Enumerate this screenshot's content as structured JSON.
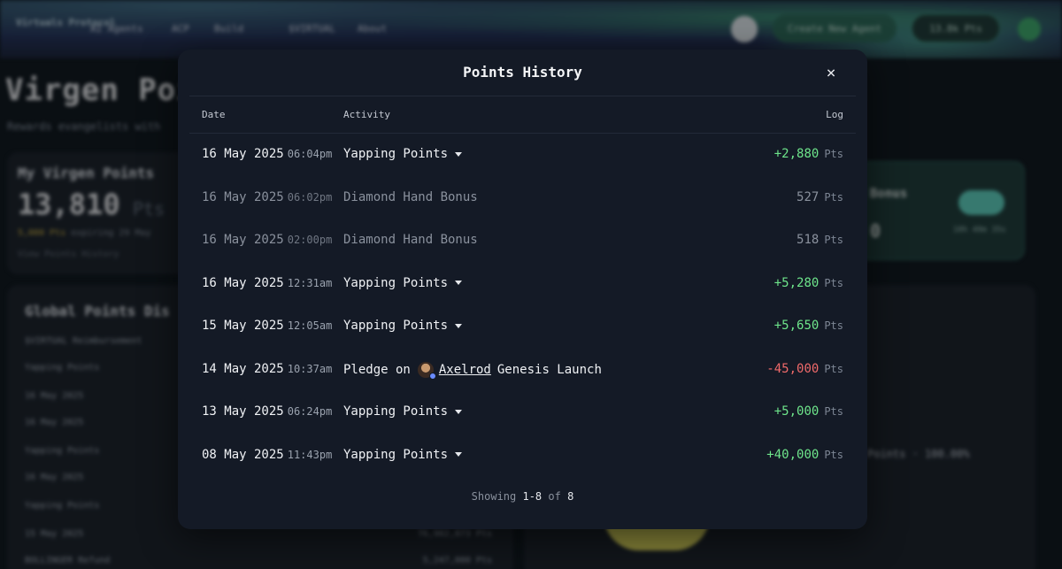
{
  "background": {
    "logo": "Virtuals Protocol",
    "nav": [
      "AI Agents",
      "ACP",
      "Build",
      "$VIRTUAL",
      "About"
    ],
    "create_agent": "Create New Agent",
    "top_points": "13.8k Pts",
    "page_title": "Virgen Poin",
    "page_subtitle": "Rewards evangelists with",
    "my_points": {
      "heading": "My Virgen Points",
      "value": "13,810",
      "unit": "Pts",
      "expiring_amount": "5,000 Pts",
      "expiring_text": "expiring 29 May",
      "claim_link": "View Points History"
    },
    "bonus": {
      "title": "Bonus",
      "value": "0",
      "sub": "10h 40m 35s"
    },
    "distribution": {
      "heading": "Global Points Dis",
      "rows": [
        "$VIRTUAL Reimbursement",
        "Yapping Points",
        "16 May 2025",
        "16 May 2025",
        "Yapping Points",
        "16 May 2025",
        "Yapping Points",
        "15 May 2025",
        "BOLLINGER Refund"
      ],
      "values": [
        "",
        "",
        "",
        "",
        "",
        "",
        "",
        "76,902,873 Pts",
        "5,247,000 Pts"
      ]
    },
    "legend": "Points · 100.00%"
  },
  "modal": {
    "title": "Points History",
    "close_label": "×",
    "columns": {
      "date": "Date",
      "activity": "Activity",
      "log": "Log"
    },
    "rows": [
      {
        "date": "16 May 2025",
        "time": "06:04pm",
        "activity": "Yapping Points",
        "expandable": true,
        "log": "+2,880",
        "unit": "Pts",
        "kind": "pos",
        "dim": false
      },
      {
        "date": "16 May 2025",
        "time": "06:02pm",
        "activity": "Diamond Hand Bonus",
        "expandable": false,
        "log": "527",
        "unit": "Pts",
        "kind": "neutral",
        "dim": true
      },
      {
        "date": "16 May 2025",
        "time": "02:00pm",
        "activity": "Diamond Hand Bonus",
        "expandable": false,
        "log": "518",
        "unit": "Pts",
        "kind": "neutral",
        "dim": true
      },
      {
        "date": "16 May 2025",
        "time": "12:31am",
        "activity": "Yapping Points",
        "expandable": true,
        "log": "+5,280",
        "unit": "Pts",
        "kind": "pos",
        "dim": false
      },
      {
        "date": "15 May 2025",
        "time": "12:05am",
        "activity": "Yapping Points",
        "expandable": true,
        "log": "+5,650",
        "unit": "Pts",
        "kind": "pos",
        "dim": false
      },
      {
        "date": "14 May 2025",
        "time": "10:37am",
        "activity_prefix": "Pledge on",
        "agent": "Axelrod",
        "activity_suffix": "Genesis Launch",
        "log": "-45,000",
        "unit": "Pts",
        "kind": "neg",
        "dim": false
      },
      {
        "date": "13 May 2025",
        "time": "06:24pm",
        "activity": "Yapping Points",
        "expandable": true,
        "log": "+5,000",
        "unit": "Pts",
        "kind": "pos",
        "dim": false
      },
      {
        "date": "08 May 2025",
        "time": "11:43pm",
        "activity": "Yapping Points",
        "expandable": true,
        "log": "+40,000",
        "unit": "Pts",
        "kind": "pos",
        "dim": false
      }
    ],
    "footer": {
      "prefix": "Showing",
      "range": "1-8",
      "of": "of",
      "total": "8"
    },
    "colors": {
      "positive": "#6ee58b",
      "negative": "#f06a6a",
      "modal_bg": "#141a26"
    }
  }
}
